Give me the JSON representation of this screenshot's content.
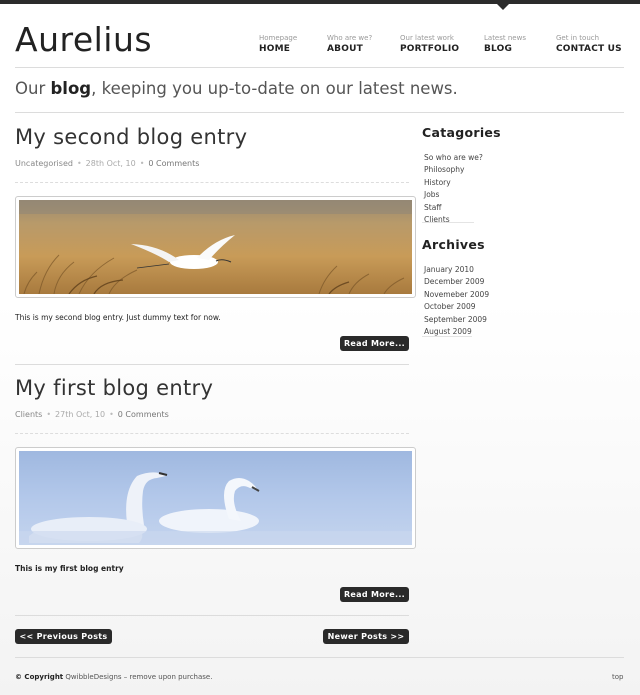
{
  "site": {
    "logo": "Aurelius"
  },
  "nav": [
    {
      "sub": "Homepage",
      "label": "HOME"
    },
    {
      "sub": "Who are we?",
      "label": "ABOUT"
    },
    {
      "sub": "Our latest work",
      "label": "PORTFOLIO"
    },
    {
      "sub": "Latest news",
      "label": "BLOG"
    },
    {
      "sub": "Get in touch",
      "label": "CONTACT US"
    }
  ],
  "tagline": {
    "before": "Our ",
    "strong": "blog",
    "after": ", keeping you up-to-date on our latest news."
  },
  "posts": [
    {
      "title": "My second blog entry",
      "category": "Uncategorised",
      "date": "28th Oct, 10",
      "comments": "0 Comments",
      "excerpt": "This is my second blog entry. Just dummy text for now.",
      "read_more": "Read More...",
      "image": "heron-over-reeds"
    },
    {
      "title": "My first blog entry",
      "category": "Clients",
      "date": "27th Oct, 10",
      "comments": "0 Comments",
      "excerpt": "This is my first blog entry",
      "read_more": "Read More...",
      "image": "swans-in-mist"
    }
  ],
  "pagination": {
    "prev": "<< Previous Posts",
    "next": "Newer Posts >>"
  },
  "sidebar": {
    "categories_title": "Catagories",
    "categories": [
      "So who are we?",
      "Philosophy",
      "History",
      "Jobs",
      "Staff",
      "Clients"
    ],
    "archives_title": "Archives",
    "archives": [
      "January 2010",
      "December 2009",
      "Novemeber 2009",
      "October 2009",
      "September 2009",
      "August 2009"
    ]
  },
  "footer": {
    "copyright_label": "© Copyright",
    "copyright_text": "QwibbleDesigns – remove upon purchase.",
    "top_link": "top"
  },
  "colors": {
    "accent": "#2a2a2a",
    "background": "#ffffff",
    "text": "#333333"
  }
}
